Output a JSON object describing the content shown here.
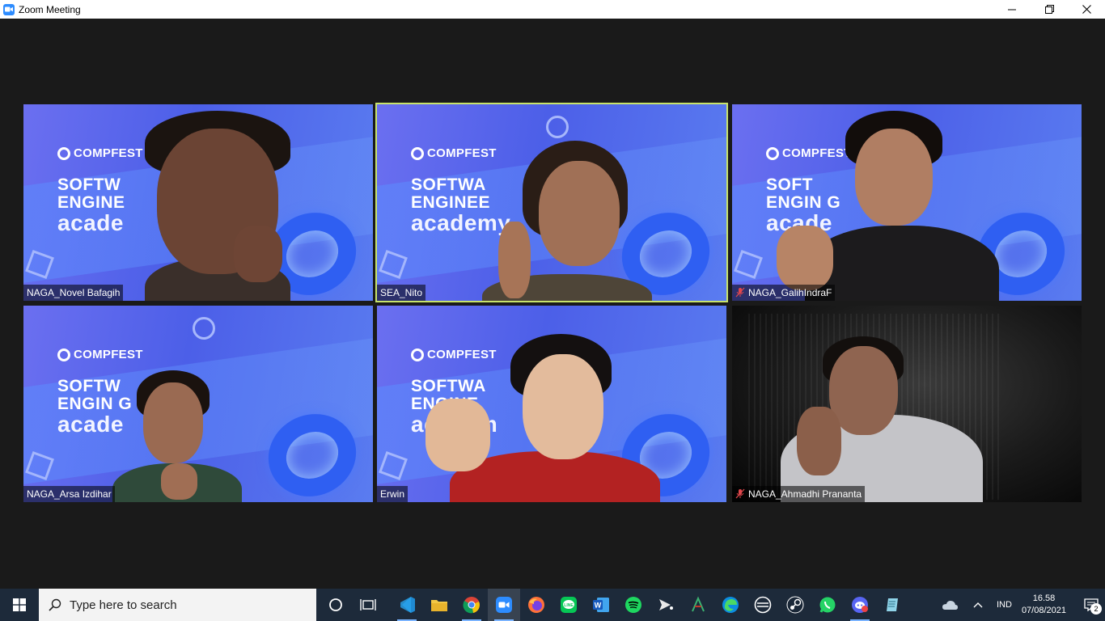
{
  "window": {
    "title": "Zoom Meeting",
    "buttons": [
      "minimize",
      "restore",
      "close"
    ]
  },
  "meeting": {
    "participants": [
      {
        "name": "NAGA_Novel Bafagih",
        "muted": false,
        "active": false,
        "background": "compfest"
      },
      {
        "name": "SEA_Nito",
        "muted": false,
        "active": true,
        "background": "compfest"
      },
      {
        "name": "NAGA_GalihIndraF",
        "muted": true,
        "active": false,
        "background": "compfest"
      },
      {
        "name": "NAGA_Arsa Izdihar",
        "muted": false,
        "active": false,
        "background": "compfest"
      },
      {
        "name": "Erwin",
        "muted": false,
        "active": false,
        "background": "compfest"
      },
      {
        "name": "NAGA_Ahmadhi Prananta",
        "muted": true,
        "active": false,
        "background": "dark-room"
      }
    ],
    "background_text": {
      "brand": "COMPFEST",
      "line1": "SOFTWARE",
      "line2": "ENGINEERING",
      "line3": "academy"
    },
    "background_text_visible": [
      {
        "line1": "SOFTW",
        "line2": "ENGINE",
        "line3": "acade"
      },
      {
        "line1": "SOFTWA",
        "line2": "ENGINEE",
        "line3": "academy"
      },
      {
        "line1": "SOFT",
        "line2": "ENGIN    G",
        "line3": "acade"
      },
      {
        "line1": "SOFTW",
        "line2": "ENGIN    G",
        "line3": "acade"
      },
      {
        "line1": "SOFTWA",
        "line2": "ENGINE",
        "line3": "academ"
      }
    ],
    "accent_active": "#c8e36b"
  },
  "taskbar": {
    "search_placeholder": "Type here to search",
    "apps": [
      "cortana-icon",
      "task-view-icon",
      "vscode-icon",
      "file-explorer-icon",
      "chrome-icon",
      "zoom-icon",
      "firefox-icon",
      "line-icon",
      "word-icon",
      "spotify-icon",
      "media-player-icon",
      "app-icon",
      "edge-icon",
      "steam-alt-icon",
      "steam-icon",
      "whatsapp-icon",
      "discord-icon",
      "notepad-icon"
    ],
    "tray": {
      "language": "IND",
      "time": "16.58",
      "date": "07/08/2021",
      "notification_count": "2"
    }
  }
}
